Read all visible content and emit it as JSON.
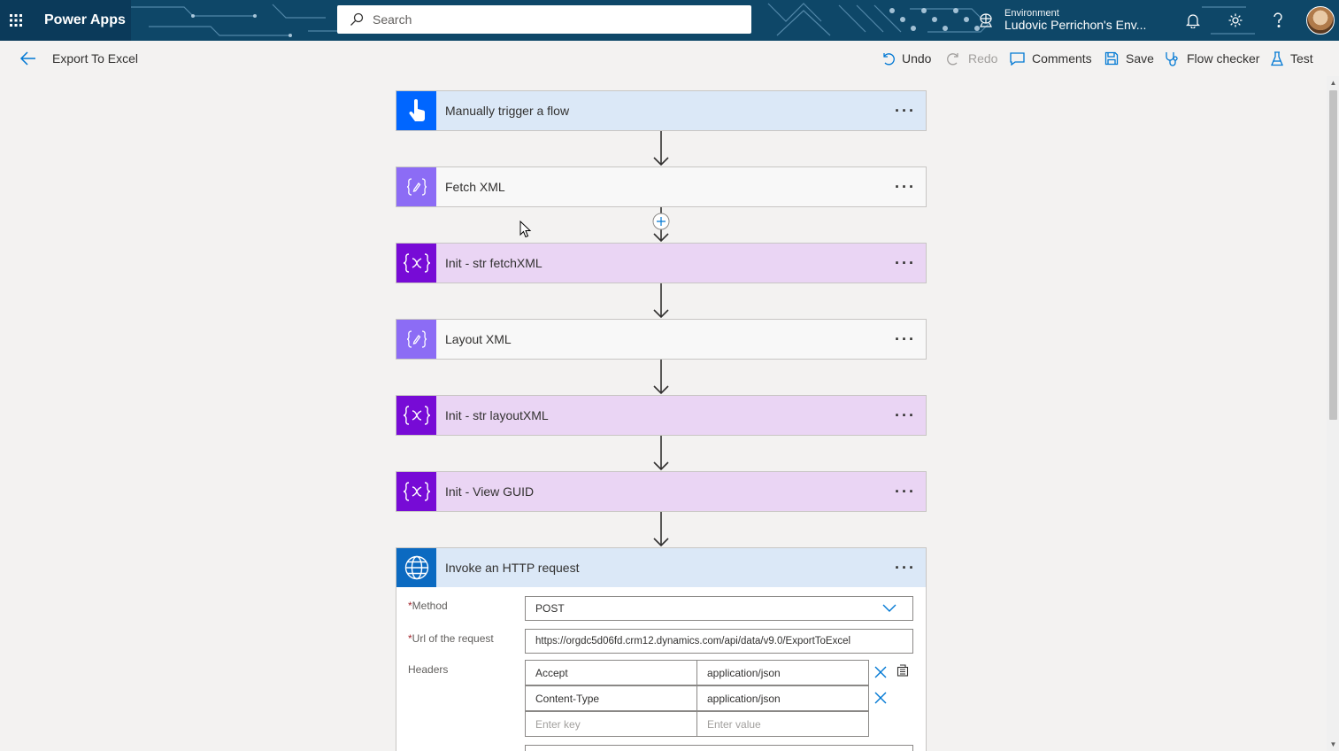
{
  "topbar": {
    "app_title": "Power Apps",
    "search_placeholder": "Search",
    "environment_label": "Environment",
    "environment_name": "Ludovic Perrichon's Env..."
  },
  "commandbar": {
    "flow_name": "Export To Excel",
    "undo": "Undo",
    "redo": "Redo",
    "comments": "Comments",
    "save": "Save",
    "flow_checker": "Flow checker",
    "test": "Test"
  },
  "steps": [
    {
      "title": "Manually trigger a flow",
      "kind": "trigger",
      "icon": "hand-touch-icon"
    },
    {
      "title": "Fetch XML",
      "kind": "compose",
      "icon": "compose-icon"
    },
    {
      "title": "Init - str fetchXML",
      "kind": "variable",
      "icon": "variable-icon"
    },
    {
      "title": "Layout XML",
      "kind": "compose",
      "icon": "compose-icon"
    },
    {
      "title": "Init - str layoutXML",
      "kind": "variable",
      "icon": "variable-icon"
    },
    {
      "title": "Init - View GUID",
      "kind": "variable",
      "icon": "variable-icon"
    },
    {
      "title": "Invoke an HTTP request",
      "kind": "http",
      "icon": "globe-icon"
    }
  ],
  "http_request": {
    "method_label": "Method",
    "method_value": "POST",
    "url_label": "Url of the request",
    "url_value": "https://orgdc5d06fd.crm12.dynamics.com/api/data/v9.0/ExportToExcel",
    "headers_label": "Headers",
    "headers": [
      {
        "key": "Accept",
        "value": "application/json"
      },
      {
        "key": "Content-Type",
        "value": "application/json"
      }
    ],
    "key_placeholder": "Enter key",
    "value_placeholder": "Enter value",
    "required_mark": "*"
  },
  "colors": {
    "topbar": "#0b3a5a",
    "accent": "#0078d4",
    "trigger": "#0066ff",
    "compose": "#8c6cf5",
    "variable": "#770bd6",
    "http": "#0b6ac1"
  }
}
